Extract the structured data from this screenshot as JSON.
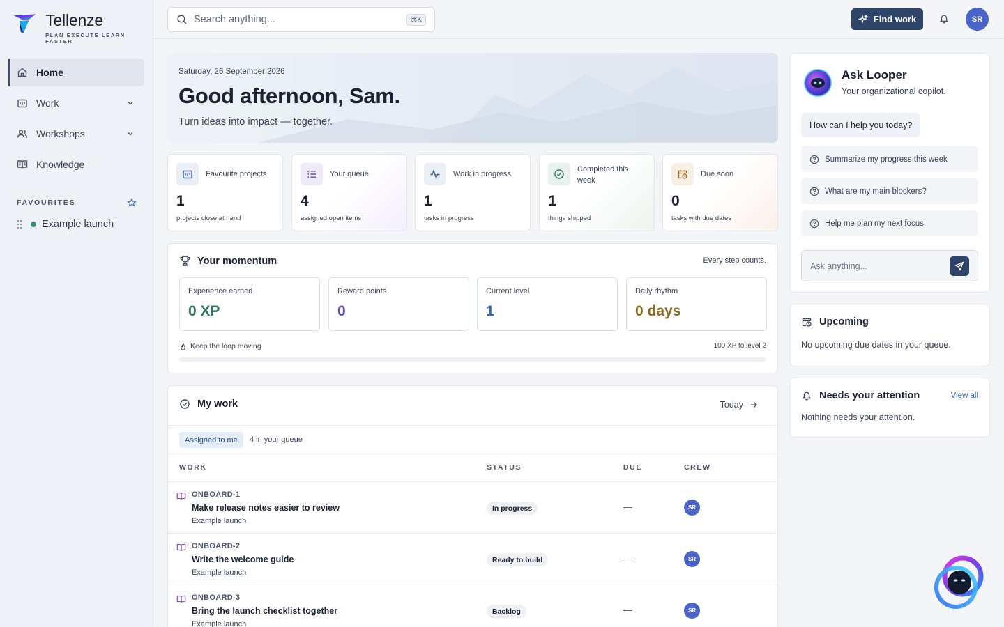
{
  "brand": {
    "name": "Tellenze",
    "tagline": "PLAN EXECUTE LEARN FASTER"
  },
  "sidebar": {
    "items": [
      {
        "label": "Home",
        "icon": "home-icon",
        "active": true
      },
      {
        "label": "Work",
        "icon": "work-icon",
        "expandable": true
      },
      {
        "label": "Workshops",
        "icon": "users-icon",
        "expandable": true
      },
      {
        "label": "Knowledge",
        "icon": "book-icon"
      }
    ],
    "favourites_title": "FAVOURITES",
    "favourites": [
      {
        "label": "Example launch",
        "color": "#2f8a7b"
      }
    ]
  },
  "topbar": {
    "search_placeholder": "Search anything...",
    "shortcut": "⌘K",
    "find_work": "Find work",
    "avatar": "SR"
  },
  "hero": {
    "date": "Saturday, 26 September 2026",
    "greeting": "Good afternoon, Sam.",
    "subtitle": "Turn ideas into impact — together."
  },
  "stats": [
    {
      "label": "Favourite projects",
      "value": "1",
      "caption": "projects close at hand",
      "icon": "folder-icon"
    },
    {
      "label": "Your queue",
      "value": "4",
      "caption": "assigned open items",
      "icon": "list-icon"
    },
    {
      "label": "Work in progress",
      "value": "1",
      "caption": "tasks in progress",
      "icon": "activity-icon"
    },
    {
      "label": "Completed this week",
      "value": "1",
      "caption": "things shipped",
      "icon": "check-circle-icon"
    },
    {
      "label": "Due soon",
      "value": "0",
      "caption": "tasks with due dates",
      "icon": "calendar-clock-icon"
    }
  ],
  "momentum": {
    "title": "Your momentum",
    "tagline": "Every step counts.",
    "boxes": [
      {
        "label": "Experience earned",
        "value": "0 XP",
        "color": "#2f7a5f"
      },
      {
        "label": "Reward points",
        "value": "0",
        "color": "#6a4bb5"
      },
      {
        "label": "Current level",
        "value": "1",
        "color": "#3b66b3"
      },
      {
        "label": "Daily rhythm",
        "value": "0 days",
        "color": "#8a6a1e"
      }
    ],
    "footer_left": "Keep the loop moving",
    "footer_right": "100 XP to level 2",
    "progress": 0
  },
  "mywork": {
    "title": "My work",
    "range": "Today",
    "filter": "Assigned to me",
    "queue_count": "4 in your queue",
    "columns": [
      "WORK",
      "STATUS",
      "DUE",
      "CREW"
    ],
    "rows": [
      {
        "key": "ONBOARD-1",
        "title": "Make release notes easier to review",
        "project": "Example launch",
        "status": "In progress",
        "due": "—",
        "crew": "SR"
      },
      {
        "key": "ONBOARD-2",
        "title": "Write the welcome guide",
        "project": "Example launch",
        "status": "Ready to build",
        "due": "—",
        "crew": "SR"
      },
      {
        "key": "ONBOARD-3",
        "title": "Bring the launch checklist together",
        "project": "Example launch",
        "status": "Backlog",
        "due": "—",
        "crew": "SR"
      }
    ]
  },
  "looper": {
    "title": "Ask Looper",
    "subtitle": "Your organizational copilot.",
    "greeting": "How can I help you today?",
    "suggestions": [
      "Summarize my progress this week",
      "What are my main blockers?",
      "Help me plan my next focus"
    ],
    "input_placeholder": "Ask anything..."
  },
  "upcoming": {
    "title": "Upcoming",
    "body": "No upcoming due dates in your queue."
  },
  "attention": {
    "title": "Needs your attention",
    "link": "View all",
    "body": "Nothing needs your attention."
  }
}
